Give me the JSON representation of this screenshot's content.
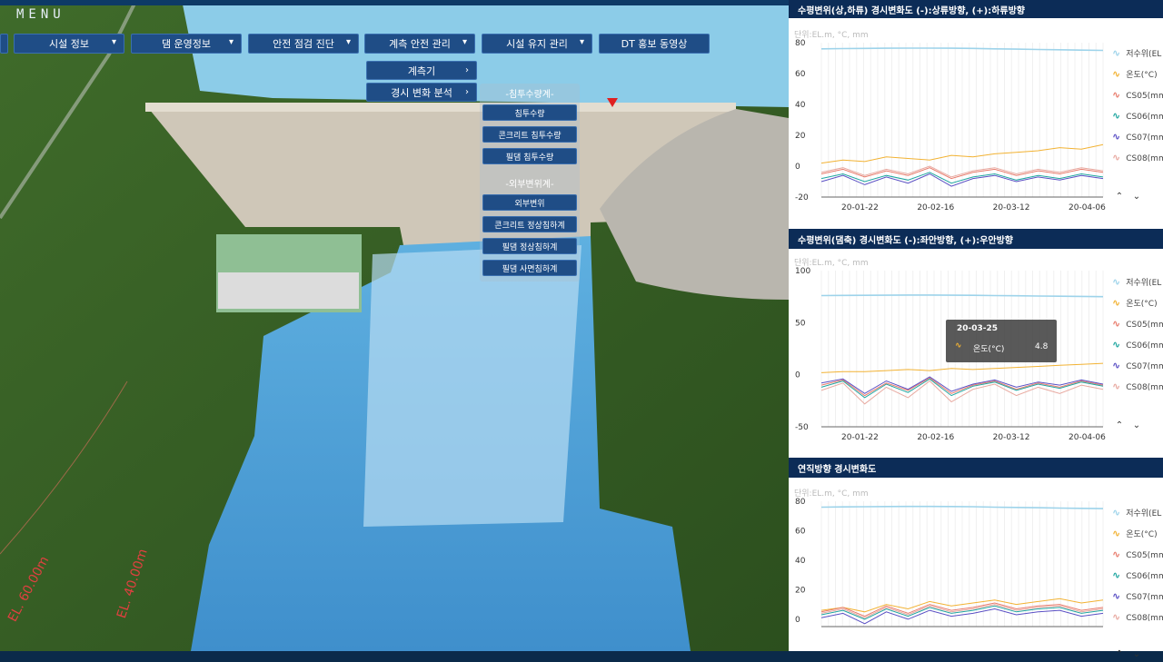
{
  "menu": {
    "title": "MENU"
  },
  "nav": [
    {
      "label": "시설 정보"
    },
    {
      "label": "댐 운영정보"
    },
    {
      "label": "안전 점검 진단"
    },
    {
      "label": "계측 안전 관리"
    },
    {
      "label": "시설 유지 관리"
    },
    {
      "label": "DT 홍보 동영상"
    }
  ],
  "submenu": [
    {
      "label": "계측기"
    },
    {
      "label": "경시 변화 분석"
    }
  ],
  "flyout": {
    "group1": "-침투수량계-",
    "group1_items": [
      "침투수량",
      "콘크리트 침투수량",
      "필댐 침투수량"
    ],
    "group2": "-외부변위계-",
    "group2_items": [
      "외부변위",
      "콘크리트 정상침하계",
      "필댐 정상침하계",
      "필댐 사면침하계"
    ]
  },
  "scene_labels": {
    "el60": "EL. 60.00m",
    "el40": "EL. 40.00m"
  },
  "colors": {
    "reservoir": "#9dd3ea",
    "temp": "#f2b233",
    "cs05": "#e87b6c",
    "cs06": "#1fa6a0",
    "cs07": "#5a4fc4",
    "cs08": "#e8a9a0"
  },
  "chart_data": [
    {
      "type": "line",
      "title": "수평변위(상,하류) 경시변화도 (-):상류방향, (+):하류방향",
      "unit": "단위:EL.m, °C, mm",
      "ylim": [
        -20,
        80
      ],
      "yticks": [
        80,
        60,
        40,
        20,
        0,
        -20
      ],
      "xticks": [
        "20-01-22",
        "20-02-16",
        "20-03-12",
        "20-04-06"
      ],
      "legend": [
        "저수위(EL",
        "온도(°C)",
        "CS05(mm",
        "CS06(mm",
        "CS07(mm",
        "CS08(mm"
      ],
      "series": [
        {
          "name": "저수위(EL",
          "values": [
            76,
            76.2,
            76.3,
            76.4,
            76.5,
            76.5,
            76.4,
            76.3,
            76,
            75.8,
            75.6,
            75.4,
            75.2,
            75.0
          ]
        },
        {
          "name": "온도(°C)",
          "values": [
            2,
            4,
            3,
            6,
            5,
            4,
            7,
            6,
            8,
            9,
            10,
            12,
            11,
            14
          ]
        },
        {
          "name": "CS05(mm",
          "values": [
            -5,
            -2,
            -7,
            -3,
            -6,
            -1,
            -8,
            -4,
            -2,
            -6,
            -3,
            -5,
            -2,
            -4
          ]
        },
        {
          "name": "CS06(mm",
          "values": [
            -8,
            -5,
            -10,
            -6,
            -9,
            -4,
            -11,
            -7,
            -5,
            -9,
            -6,
            -8,
            -5,
            -7
          ]
        },
        {
          "name": "CS07(mm",
          "values": [
            -10,
            -6,
            -12,
            -7,
            -11,
            -5,
            -13,
            -8,
            -6,
            -10,
            -7,
            -9,
            -6,
            -8
          ]
        },
        {
          "name": "CS08(mm",
          "values": [
            -4,
            -1,
            -6,
            -2,
            -5,
            0,
            -7,
            -3,
            -1,
            -5,
            -2,
            -4,
            -1,
            -3
          ]
        }
      ]
    },
    {
      "type": "line",
      "title": "수평변위(댐축) 경시변화도 (-):좌안방향, (+):우안방향",
      "unit": "단위:EL.m, °C, mm",
      "ylim": [
        -50,
        100
      ],
      "yticks": [
        100,
        50,
        0,
        -50
      ],
      "xticks": [
        "20-01-22",
        "20-02-16",
        "20-03-12",
        "20-04-06"
      ],
      "legend": [
        "저수위(EL",
        "온도(°C)",
        "CS05(mm",
        "CS06(mm",
        "CS07(mm",
        "CS08(mm"
      ],
      "tooltip": {
        "date": "20-03-25",
        "label": "온도(°C)",
        "value": "4.8"
      },
      "series": [
        {
          "name": "저수위(EL",
          "values": [
            76,
            76.2,
            76.3,
            76.4,
            76.5,
            76.5,
            76.4,
            76.3,
            76,
            75.8,
            75.6,
            75.4,
            75.2,
            75.0
          ]
        },
        {
          "name": "온도(°C)",
          "values": [
            2,
            3,
            3,
            4,
            5,
            4,
            6,
            5,
            6,
            7,
            8,
            9,
            10,
            11
          ]
        },
        {
          "name": "CS05(mm",
          "values": [
            -10,
            -5,
            -20,
            -8,
            -15,
            -3,
            -18,
            -10,
            -6,
            -14,
            -8,
            -12,
            -6,
            -10
          ]
        },
        {
          "name": "CS06(mm",
          "values": [
            -12,
            -6,
            -22,
            -9,
            -17,
            -4,
            -20,
            -11,
            -7,
            -15,
            -9,
            -13,
            -7,
            -11
          ]
        },
        {
          "name": "CS07(mm",
          "values": [
            -8,
            -4,
            -18,
            -6,
            -14,
            -2,
            -16,
            -9,
            -5,
            -12,
            -7,
            -10,
            -5,
            -9
          ]
        },
        {
          "name": "CS08(mm",
          "values": [
            -15,
            -8,
            -28,
            -12,
            -22,
            -6,
            -26,
            -14,
            -9,
            -20,
            -12,
            -18,
            -10,
            -14
          ]
        }
      ]
    },
    {
      "type": "line",
      "title": "연직방향 경시변화도",
      "unit": "단위:EL.m, °C, mm",
      "ylim": [
        -5,
        80
      ],
      "yticks": [
        80,
        60,
        40,
        20,
        0
      ],
      "xticks": [],
      "legend": [
        "저수위(EL",
        "온도(°C)",
        "CS05(mm",
        "CS06(mm",
        "CS07(mm",
        "CS08(mm"
      ],
      "series": [
        {
          "name": "저수위(EL",
          "values": [
            76,
            76.2,
            76.3,
            76.4,
            76.5,
            76.5,
            76.4,
            76.3,
            76,
            75.8,
            75.6,
            75.4,
            75.2,
            75.0
          ]
        },
        {
          "name": "온도(°C)",
          "values": [
            6,
            8,
            5,
            10,
            7,
            12,
            9,
            11,
            13,
            10,
            12,
            14,
            11,
            13
          ]
        },
        {
          "name": "CS05(mm",
          "values": [
            5,
            8,
            2,
            9,
            4,
            10,
            6,
            8,
            11,
            7,
            9,
            10,
            6,
            8
          ]
        },
        {
          "name": "CS06(mm",
          "values": [
            3,
            6,
            0,
            7,
            2,
            8,
            4,
            6,
            9,
            5,
            7,
            8,
            4,
            6
          ]
        },
        {
          "name": "CS07(mm",
          "values": [
            1,
            4,
            -3,
            5,
            0,
            6,
            2,
            4,
            7,
            3,
            5,
            6,
            2,
            4
          ]
        },
        {
          "name": "CS08(mm",
          "values": [
            4,
            7,
            1,
            8,
            3,
            9,
            5,
            7,
            10,
            6,
            8,
            9,
            5,
            7
          ]
        }
      ]
    }
  ]
}
